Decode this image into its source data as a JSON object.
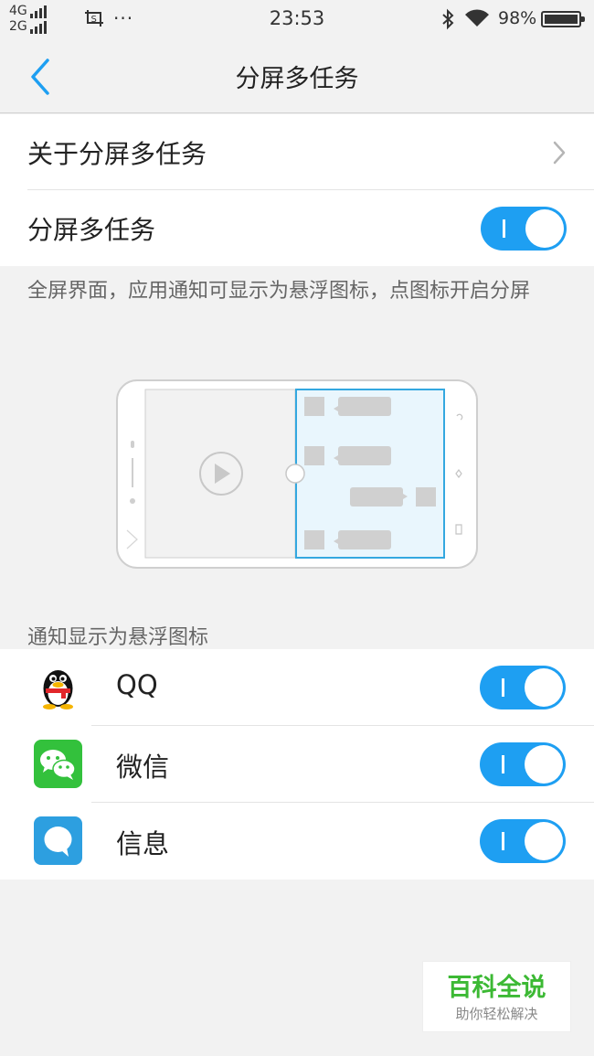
{
  "status_bar": {
    "network_top": "4G",
    "network_bottom": "2G",
    "overflow": "···",
    "time": "23:53",
    "battery": "98%"
  },
  "nav": {
    "title": "分屏多任务",
    "back_icon": "chevron-left-icon"
  },
  "settings": {
    "about_label": "关于分屏多任务",
    "split_label": "分屏多任务",
    "split_enabled": true
  },
  "description": "全屏界面，应用通知可显示为悬浮图标，点图标开启分屏",
  "section_header": "通知显示为悬浮图标",
  "apps": [
    {
      "name": "QQ",
      "icon": "qq-penguin-icon",
      "enabled": true
    },
    {
      "name": "微信",
      "icon": "wechat-icon",
      "enabled": true
    },
    {
      "name": "信息",
      "icon": "messages-icon",
      "enabled": true
    }
  ],
  "watermark": {
    "title": "百科全说",
    "subtitle": "助你轻松解决"
  },
  "colors": {
    "accent": "#1e9ff2",
    "background": "#f2f2f2",
    "watermark_green": "#3cb934"
  }
}
